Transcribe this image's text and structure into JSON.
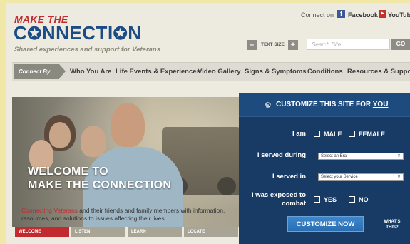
{
  "header": {
    "logo_top": "MAKE THE",
    "logo_main": "C",
    "logo_main_mid": "NNECTI",
    "logo_main_end": "N",
    "tagline": "Shared experiences and support for Veterans",
    "connect_on": "Connect on",
    "facebook": "Facebook",
    "youtube": "YouTube",
    "text_size": "TEXT SIZE",
    "minus": "–",
    "plus": "+",
    "search_placeholder": "Search Site",
    "go": "GO"
  },
  "nav": {
    "connect_by": "Connect By",
    "items": [
      "Who You Are",
      "Life Events & Experiences",
      "Video Gallery",
      "Signs & Symptoms",
      "Conditions",
      "Resources & Support"
    ]
  },
  "hero": {
    "welcome_line1": "WELCOME TO",
    "welcome_line2": "MAKE THE CONNECTION",
    "desc_highlight": "Connecting Veterans",
    "desc_rest": " and their friends and family members with information, resources, and solutions to issues affecting their lives.",
    "tabs": [
      "WELCOME",
      "LISTEN",
      "LEARN",
      "LOCATE"
    ]
  },
  "customize": {
    "title_prefix": "CUSTOMIZE THIS SITE FOR ",
    "title_you": "YOU",
    "i_am_label": "I am",
    "male": "MALE",
    "female": "FEMALE",
    "served_during_label": "I served during",
    "era_select": "Select an Era",
    "served_in_label": "I served in",
    "service_select": "Select your Service",
    "exposed_label_1": "I was exposed to",
    "exposed_label_2": "combat",
    "yes": "YES",
    "no": "NO",
    "button": "CUSTOMIZE NOW",
    "whats_this_1": "WHAT'S",
    "whats_this_2": "THIS?"
  },
  "colors": {
    "brand_red": "#c12b2f",
    "brand_blue": "#1c4c86",
    "panel_blue": "#183b66",
    "button_blue": "#2a6eb2"
  }
}
